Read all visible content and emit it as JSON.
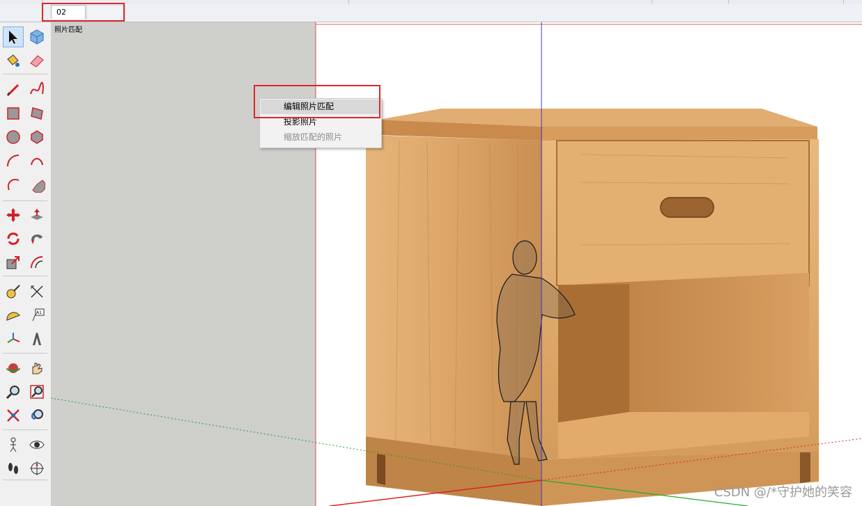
{
  "scenes": {
    "tab_label": "02"
  },
  "viewport": {
    "scene_label": "照片匹配"
  },
  "context_menu": {
    "items": [
      {
        "label": "编辑照片匹配",
        "state": "hover"
      },
      {
        "label": "投影照片",
        "state": "normal"
      },
      {
        "label": "缩放匹配的照片",
        "state": "disabled"
      }
    ]
  },
  "watermark": "CSDN @/*守护她的笑容",
  "toolbar": {
    "tools": [
      "select-icon",
      "component-icon",
      "paint-bucket-icon",
      "eraser-icon",
      "pencil-line-icon",
      "freehand-icon",
      "rectangle-icon",
      "rotated-rectangle-icon",
      "circle-icon",
      "polygon-icon",
      "arc-icon",
      "two-point-arc-icon",
      "three-point-arc-icon",
      "pie-icon",
      "move-icon",
      "push-pull-icon",
      "rotate-icon",
      "follow-me-icon",
      "scale-icon",
      "offset-icon",
      "tape-measure-icon",
      "dimension-icon",
      "protractor-icon",
      "text-label-icon",
      "axes-icon",
      "3d-text-icon",
      "orbit-icon",
      "pan-icon",
      "zoom-icon",
      "zoom-window-icon",
      "zoom-extents-icon",
      "previous-view-icon",
      "position-camera-icon",
      "look-around-icon",
      "walk-icon",
      "section-plane-icon",
      "warehouse-icon",
      "extension-icon"
    ]
  },
  "colors": {
    "highlight": "#e2242b",
    "wood": "#d9a466",
    "gray_background": "#cfcfcc"
  }
}
